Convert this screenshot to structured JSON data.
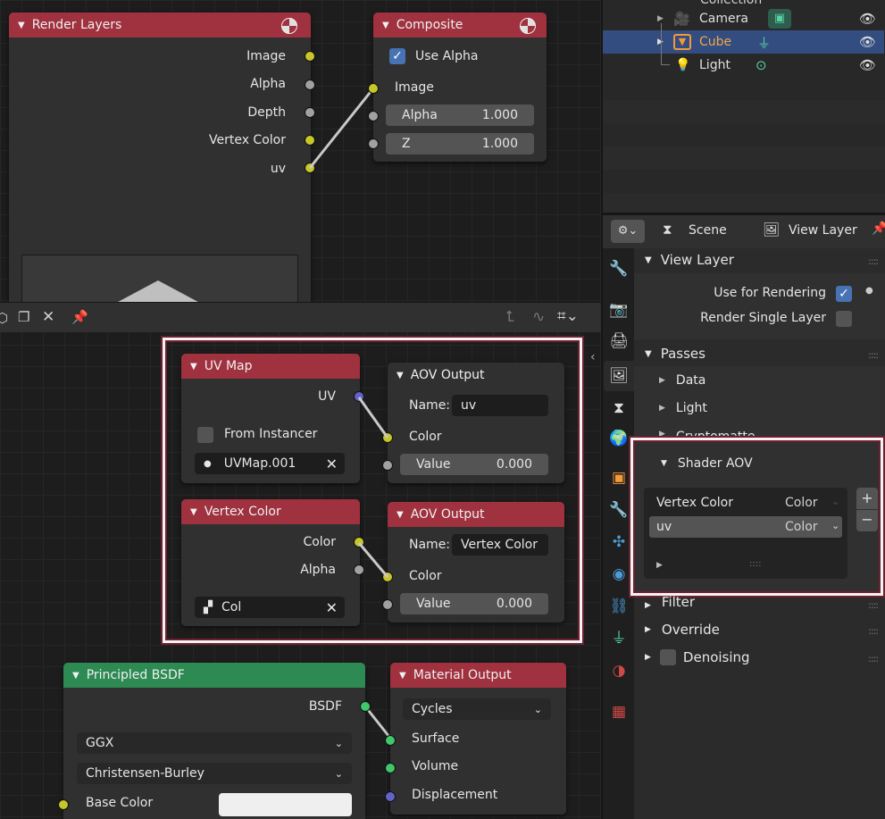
{
  "compositor": {
    "render_layers": {
      "title": "Render Layers",
      "outputs": [
        "Image",
        "Alpha",
        "Depth",
        "Vertex Color",
        "uv"
      ]
    },
    "composite": {
      "title": "Composite",
      "use_alpha_label": "Use Alpha",
      "image_label": "Image",
      "alpha_label": "Alpha",
      "alpha_value": "1.000",
      "z_label": "Z",
      "z_value": "1.000"
    }
  },
  "shader_editor": {
    "uv_map": {
      "title": "UV Map",
      "output": "UV",
      "from_instancer": "From Instancer",
      "map_name": "UVMap.001"
    },
    "aov_output_1": {
      "title": "AOV Output",
      "name_label": "Name:",
      "name_value": "uv",
      "color_label": "Color",
      "value_label": "Value",
      "value": "0.000"
    },
    "vertex_color": {
      "title": "Vertex Color",
      "output_color": "Color",
      "output_alpha": "Alpha",
      "layer": "Col"
    },
    "aov_output_2": {
      "title": "AOV Output",
      "name_label": "Name:",
      "name_value": "Vertex Color",
      "color_label": "Color",
      "value_label": "Value",
      "value": "0.000"
    },
    "principled": {
      "title": "Principled BSDF",
      "output": "BSDF",
      "distribution": "GGX",
      "subsurface": "Christensen-Burley",
      "base_color_label": "Base Color"
    },
    "material_output": {
      "title": "Material Output",
      "target": "Cycles",
      "inputs": [
        "Surface",
        "Volume",
        "Displacement"
      ]
    }
  },
  "outliner": {
    "top_item": "Collection",
    "items": [
      {
        "label": "Camera",
        "selected": false
      },
      {
        "label": "Cube",
        "selected": true
      },
      {
        "label": "Light",
        "selected": false
      }
    ]
  },
  "properties": {
    "header": {
      "scene": "Scene",
      "view_layer": "View Layer"
    },
    "view_layer_panel": "View Layer",
    "use_for_rendering": "Use for Rendering",
    "render_single_layer": "Render Single Layer",
    "passes_panel": "Passes",
    "passes_sub": [
      "Data",
      "Light",
      "Cryptomatte"
    ],
    "shader_aov_panel": "Shader AOV",
    "aov_list": [
      {
        "name": "Vertex Color",
        "type": "Color"
      },
      {
        "name": "uv",
        "type": "Color"
      }
    ],
    "filter_panel": "Filter",
    "override_panel": "Override",
    "denoising_panel": "Denoising"
  },
  "colors": {
    "node_header_red": "#a0313f",
    "node_header_green": "#2c8a52",
    "selection_blue": "#334d80",
    "socket_yellow": "#c7c729",
    "socket_gray": "#a1a1a1",
    "socket_purple": "#6363c7",
    "socket_green": "#3fc76b",
    "highlight_frame": "#f3f3f3"
  }
}
